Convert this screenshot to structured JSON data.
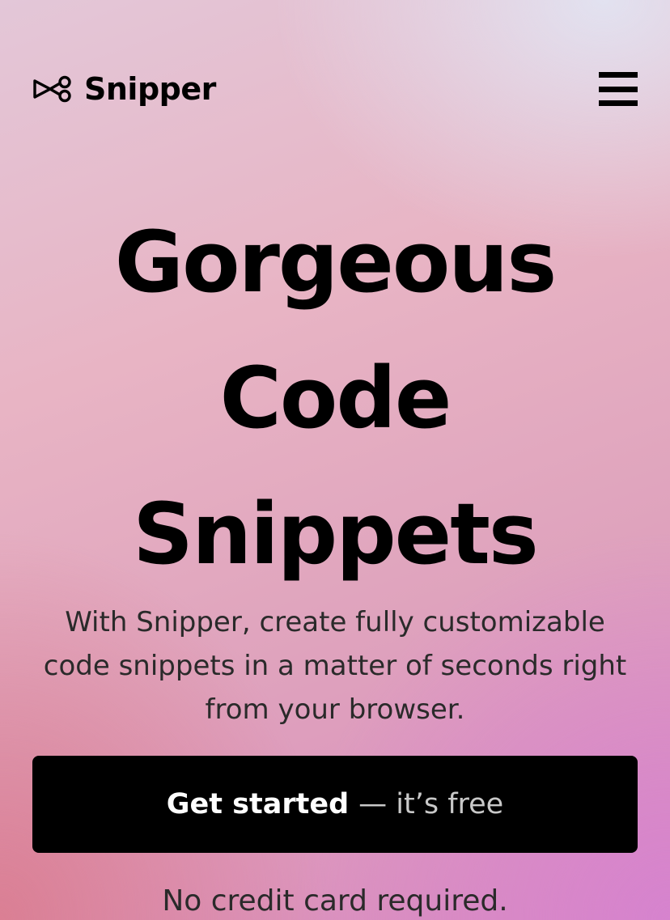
{
  "header": {
    "brand_name": "Snipper",
    "logo_icon": "scissors-icon",
    "menu_icon": "hamburger-menu-icon"
  },
  "hero": {
    "title_lines": [
      "Gorgeous",
      "Code",
      "Snippets"
    ],
    "subtitle": "With Snipper, create fully customizable code snippets in a matter of seconds right from your browser."
  },
  "cta": {
    "label": "Get started",
    "sub_label": "— it’s free"
  },
  "footnote": "No credit card required.",
  "colors": {
    "text": "#000000",
    "button_bg": "#000000",
    "button_text": "#ffffff",
    "button_subtext": "#c9c9c9",
    "gradient_top": "#e3c7d8",
    "gradient_left": "#da7a8c",
    "gradient_right": "#d682d0"
  }
}
